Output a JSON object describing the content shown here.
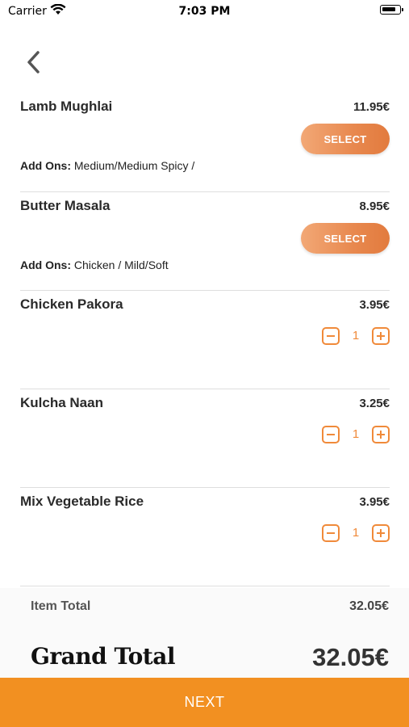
{
  "status_bar": {
    "carrier": "Carrier",
    "time": "7:03 PM"
  },
  "nav": {
    "back_icon": "chevron-left-icon"
  },
  "items": [
    {
      "name": "Lamb Mughlai",
      "price": "11.95€",
      "select_label": "SELECT",
      "addons_label": "Add Ons:",
      "addons": "Medium/Medium Spicy /"
    },
    {
      "name": "Butter Masala",
      "price": "8.95€",
      "select_label": "SELECT",
      "addons_label": "Add Ons:",
      "addons": "Chicken / Mild/Soft"
    },
    {
      "name": "Chicken Pakora",
      "price": "3.95€",
      "quantity": "1"
    },
    {
      "name": "Kulcha Naan",
      "price": "3.25€",
      "quantity": "1"
    },
    {
      "name": "Mix Vegetable Rice",
      "price": "3.95€",
      "quantity": "1"
    }
  ],
  "summary": {
    "item_total_label": "Item Total",
    "item_total_value": "32.05€",
    "grand_total_label": "Grand Total",
    "grand_total_value": "32.05€"
  },
  "footer": {
    "next_label": "NEXT"
  },
  "colors": {
    "accent": "#f29021",
    "select_gradient_start": "#f2a876",
    "select_gradient_end": "#e27b3e"
  }
}
